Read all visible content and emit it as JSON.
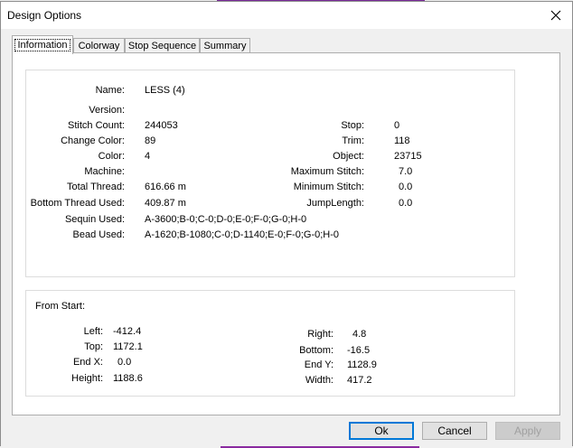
{
  "window": {
    "title": "Design Options"
  },
  "tabs": [
    {
      "label": "Information"
    },
    {
      "label": "Colorway"
    },
    {
      "label": "Stop Sequence"
    },
    {
      "label": "Summary"
    }
  ],
  "info": {
    "name": {
      "label": "Name:",
      "value": "LESS (4)"
    },
    "version": {
      "label": "Version:",
      "value": ""
    },
    "stitch_count": {
      "label": "Stitch Count:",
      "value": "244053"
    },
    "change_color": {
      "label": "Change Color:",
      "value": "89"
    },
    "color": {
      "label": "Color:",
      "value": "4"
    },
    "machine": {
      "label": "Machine:",
      "value": ""
    },
    "total_thread": {
      "label": "Total Thread:",
      "value": "616.66 m"
    },
    "bottom_thread": {
      "label": "Bottom Thread Used:",
      "value": "409.87 m"
    },
    "sequin_used": {
      "label": "Sequin Used:",
      "value": "A-3600;B-0;C-0;D-0;E-0;F-0;G-0;H-0"
    },
    "bead_used": {
      "label": "Bead Used:",
      "value": "A-1620;B-1080;C-0;D-1140;E-0;F-0;G-0;H-0"
    },
    "stop": {
      "label": "Stop:",
      "value": "0"
    },
    "trim": {
      "label": "Trim:",
      "value": "118"
    },
    "object": {
      "label": "Object:",
      "value": "23715"
    },
    "max_stitch": {
      "label": "Maximum Stitch:",
      "value": "7.0"
    },
    "min_stitch": {
      "label": "Minimum Stitch:",
      "value": "0.0"
    },
    "jump_length": {
      "label": "JumpLength:",
      "value": "0.0"
    }
  },
  "from_start": {
    "heading": "From Start:",
    "left": {
      "label": "Left:",
      "value": "-412.4"
    },
    "top": {
      "label": "Top:",
      "value": "1172.1"
    },
    "end_x": {
      "label": "End X:",
      "value": "0.0"
    },
    "height": {
      "label": "Height:",
      "value": "1188.6"
    },
    "right": {
      "label": "Right:",
      "value": "4.8"
    },
    "bottom": {
      "label": "Bottom:",
      "value": "-16.5"
    },
    "end_y": {
      "label": "End Y:",
      "value": "1128.9"
    },
    "width": {
      "label": "Width:",
      "value": "417.2"
    }
  },
  "buttons": {
    "ok": "Ok",
    "cancel": "Cancel",
    "apply": "Apply"
  }
}
